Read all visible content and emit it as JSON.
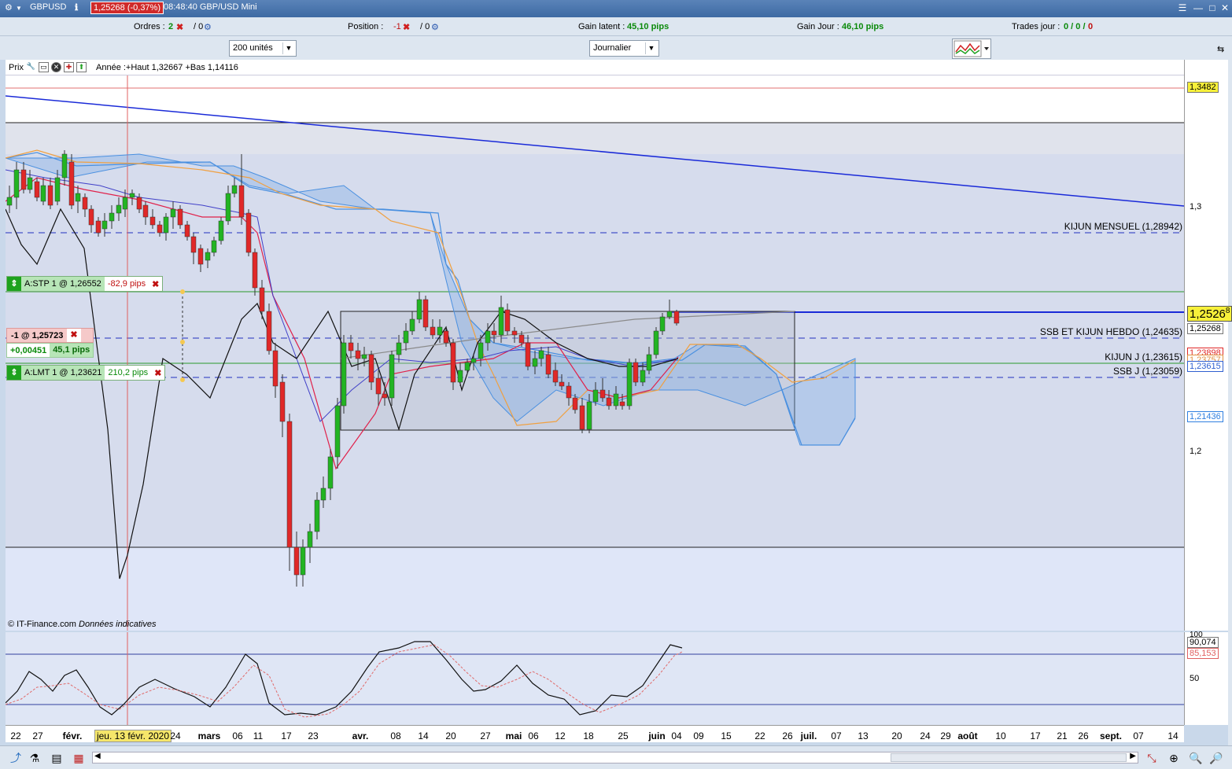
{
  "title_bar": {
    "symbol": "GBPUSD",
    "price_change": "1,25268 (-0,37%)",
    "time_title": "08:48:40 GBP/USD Mini"
  },
  "info_bar": {
    "orders_label": "Ordres :",
    "orders_count": "2",
    "orders_sep": "/ 0",
    "position_label": "Position :",
    "position_value": "-1",
    "position_sep": "/ 0",
    "gain_latent_label": "Gain latent :",
    "gain_latent_value": "45,10 pips",
    "gain_jour_label": "Gain Jour :",
    "gain_jour_value": "46,10 pips",
    "trades_label": "Trades jour :",
    "trades_value": "0 / 0 /",
    "trades_last": "0"
  },
  "controls": {
    "units": "200 unités",
    "period": "Journalier"
  },
  "chart_header": {
    "prix_label": "Prix",
    "annee_text": "Année :+Haut 1,32667 +Bas 1,14116"
  },
  "orders": {
    "stop_label": "A:STP  1 @ 1,26552",
    "stop_pips": "-82,9 pips",
    "position_label": "-1 @ 1,25723",
    "position_pnl": "+0,00451",
    "position_pips": "45,1 pips",
    "limit_label": "A:LMT  1 @ 1,23621",
    "limit_pips": "210,2 pips"
  },
  "line_labels": {
    "kijun_mensuel": "KIJUN MENSUEL (1,28942)",
    "ssb_kijun_hebdo": "SSB ET KIJUN HEBDO (1,24635)",
    "kijun_j": "KIJUN J (1,23615)",
    "ssb_j": "SSB J (1,23059)"
  },
  "price_axis": {
    "top_box": "1,3482",
    "tick_13": "1,3",
    "tick_12": "1,2",
    "current_price": "1,2526",
    "current_price_sup": "8",
    "box_125268": "1,25268",
    "box_123898": "1,23898",
    "box_123757": "1,23757",
    "box_123615": "1,23615",
    "box_121436": "1,21436"
  },
  "oscillator_axis": {
    "tick_100": "100",
    "value_main": "90,074",
    "value_signal": "85,153",
    "tick_50": "50"
  },
  "credit": {
    "source": "© IT-Finance.com",
    "note": "Données indicatives"
  },
  "date_axis": {
    "ticks": [
      "22",
      "27",
      "févr.",
      "jeu. 13 févr. 2020",
      "24",
      "mars",
      "06",
      "11",
      "17",
      "23",
      "avr.",
      "08",
      "14",
      "20",
      "27",
      "mai",
      "06",
      "12",
      "18",
      "25",
      "juin",
      "04",
      "09",
      "15",
      "22",
      "26",
      "juil.",
      "07",
      "13",
      "20",
      "24",
      "29",
      "août",
      "10",
      "17",
      "21",
      "26",
      "sept.",
      "07",
      "14"
    ]
  },
  "colors": {
    "bull": "#22b422",
    "bear": "#e02828",
    "kijun": "#e0204a",
    "tenkan": "#4040c8",
    "span_a": "#f0a040",
    "span_b": "#4a90e0",
    "trend": "#1a2ad8"
  }
}
